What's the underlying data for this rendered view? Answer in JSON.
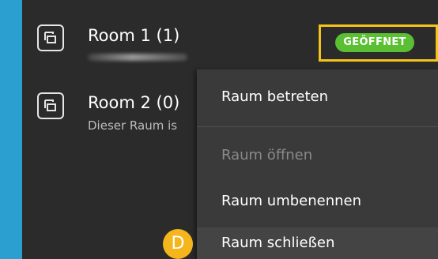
{
  "rooms": [
    {
      "title": "Room 1 (1)",
      "subtitle": "",
      "icon": "room-icon",
      "badge": "GEÖFFNET"
    },
    {
      "title": "Room 2 (0)",
      "subtitle": "Dieser Raum is",
      "icon": "room-icon"
    }
  ],
  "context_menu": {
    "items": [
      {
        "label": "Raum betreten",
        "enabled": true
      },
      {
        "label": "Raum öffnen",
        "enabled": false
      },
      {
        "label": "Raum umbenennen",
        "enabled": true
      },
      {
        "label": "Raum schließen",
        "enabled": true
      }
    ]
  },
  "callout_marker": "D",
  "colors": {
    "background": "#2b9fcf",
    "panel": "#2b2b2b",
    "menu": "#3a3a3a",
    "badge_green": "#5bbf33",
    "highlight_yellow": "#f6c418",
    "marker_orange": "#f5b51c"
  }
}
